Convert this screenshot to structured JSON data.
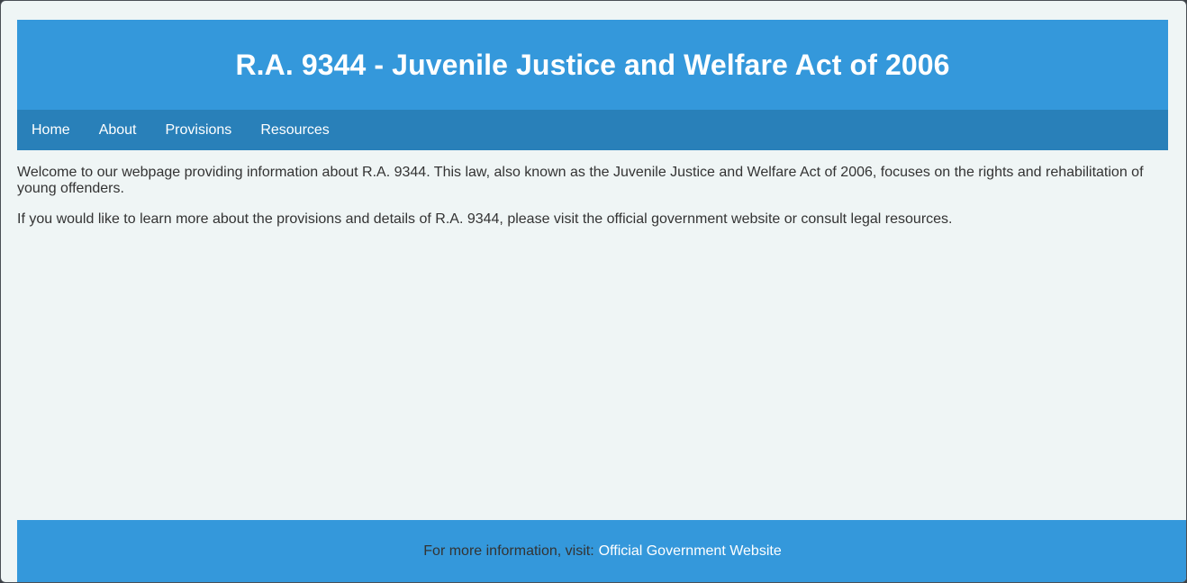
{
  "header": {
    "title": "R.A. 9344 - Juvenile Justice and Welfare Act of 2006"
  },
  "nav": {
    "items": [
      {
        "label": "Home"
      },
      {
        "label": "About"
      },
      {
        "label": "Provisions"
      },
      {
        "label": "Resources"
      }
    ]
  },
  "content": {
    "paragraphs": [
      "Welcome to our webpage providing information about R.A. 9344. This law, also known as the Juvenile Justice and Welfare Act of 2006, focuses on the rights and rehabilitation of young offenders.",
      "If you would like to learn more about the provisions and details of R.A. 9344, please visit the official government website or consult legal resources."
    ]
  },
  "footer": {
    "text": "For more information, visit:",
    "link_label": "Official Government Website"
  },
  "colors": {
    "header_bg": "#3498db",
    "nav_bg": "#2980b9",
    "page_bg": "#eff5f5",
    "text": "#333333",
    "link": "#ffffff"
  }
}
